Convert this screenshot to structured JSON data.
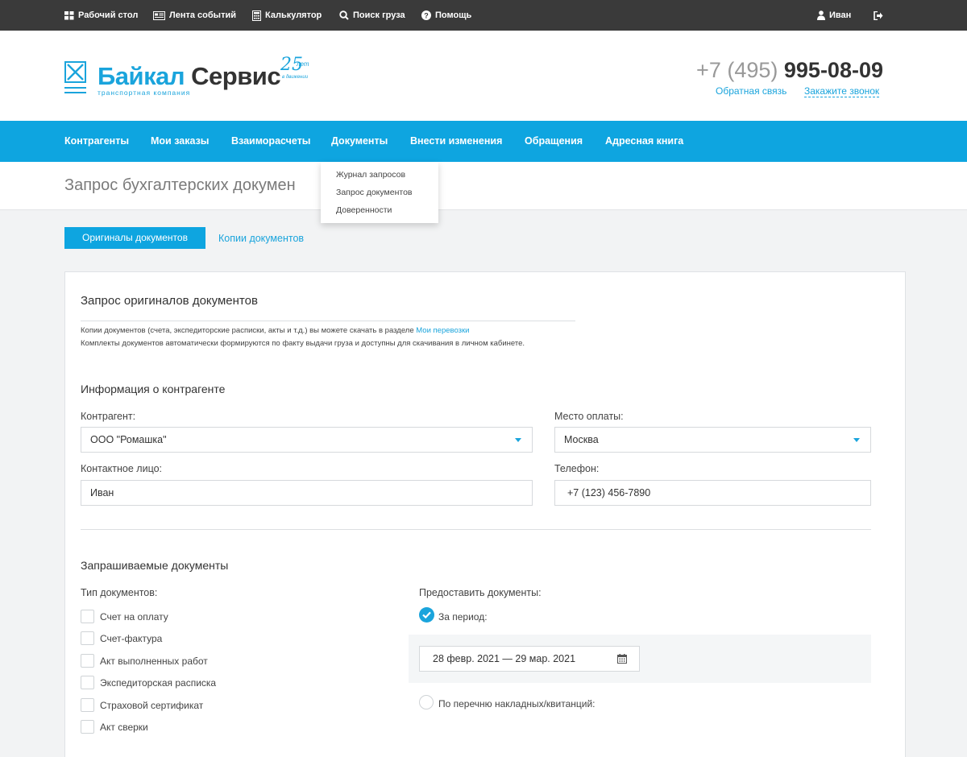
{
  "topbar": {
    "desktop": "Рабочий стол",
    "events": "Лента событий",
    "calculator": "Калькулятор",
    "search": "Поиск груза",
    "help": "Помощь",
    "user": "Иван"
  },
  "header": {
    "logo_part1": "Байкал",
    "logo_part2": "Сервис",
    "logo_tagline": "транспортная компания",
    "anniversary_number": "25",
    "anniversary_word": "лет",
    "anniversary_sub": "в движении",
    "phone_code": "+7 (495)",
    "phone_number": "995-08-09",
    "feedback": "Обратная связь",
    "callback": "Закажите звонок"
  },
  "nav": {
    "items": [
      "Контрагенты",
      "Мои заказы",
      "Взаиморасчеты",
      "Документы",
      "Внести изменения",
      "Обращения",
      "Адресная книга"
    ]
  },
  "dropdown": {
    "items": [
      "Журнал запросов",
      "Запрос документов",
      "Доверенности"
    ]
  },
  "page": {
    "title": "Запрос бухгалтерских докумен"
  },
  "tabs": {
    "originals": "Оригиналы документов",
    "copies": "Копии документов"
  },
  "form": {
    "heading": "Запрос оригиналов документов",
    "note1_prefix": "Копии документов (счета, экспедиторские расписки, акты и т.д.) вы можете скачать в разделе ",
    "note1_link": "Мои перевозки",
    "note2": "Комплекты документов автоматически формируются по факту выдачи груза и доступны для скачивания в личном кабинете.",
    "contractor_section": "Информация о контрагенте",
    "contractor_label": "Контрагент:",
    "contractor_value": "ООО \"Ромашка\"",
    "payment_place_label": "Место оплаты:",
    "payment_place_value": "Москва",
    "contact_label": "Контактное лицо:",
    "contact_value": "Иван",
    "phone_label": "Телефон:",
    "phone_value": "+7 (123) 456-7890",
    "docs_section": "Запрашиваемые документы",
    "doc_type_label": "Тип документов:",
    "doc_types": [
      "Счет на оплату",
      "Счет-фактура",
      "Акт выполненных работ",
      "Экспедиторская расписка",
      "Страховой сертификат",
      "Акт сверки"
    ],
    "provide_label": "Предоставить документы:",
    "option_period": "За период:",
    "date_range": "28 февр. 2021 — 29 мар. 2021",
    "option_list": "По перечню накладных/квитанций:"
  },
  "colors": {
    "accent": "#0ea5e0",
    "topbar": "#3a3a3a"
  },
  "icons": {
    "desktop": "grid-icon",
    "events": "newspaper-icon",
    "calculator": "calculator-icon",
    "search": "search-icon",
    "help": "help-circle-icon",
    "user": "user-icon",
    "logout": "logout-icon",
    "calendar": "calendar-icon"
  }
}
